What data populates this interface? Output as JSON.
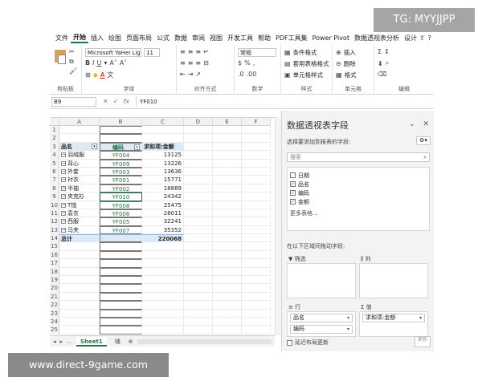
{
  "watermark": {
    "tg": "TG: MYYJJPP",
    "url": "www.direct-9game.com"
  },
  "ribbon": {
    "tabs": [
      "文件",
      "开始",
      "插入",
      "绘图",
      "页面布局",
      "公式",
      "数据",
      "审阅",
      "视图",
      "开发工具",
      "帮助",
      "PDF工具集",
      "Power Pivot",
      "数据透视表分析",
      "设计"
    ],
    "active_tab": "开始",
    "font_name": "Microsoft YaHei Lig",
    "font_size": "11",
    "number_format": "常规",
    "bold": "B",
    "italic": "I",
    "underline": "U",
    "cond_format": "条件格式",
    "table_format": "套用表格格式",
    "cell_style": "单元格样式",
    "insert": "插入",
    "delete": "删除",
    "format": "格式",
    "groups": [
      "剪贴板",
      "字体",
      "对齐方式",
      "数字",
      "样式",
      "单元格",
      "编辑"
    ]
  },
  "formula_bar": {
    "name_box": "B9",
    "value": "YF010",
    "fx": "fx"
  },
  "grid": {
    "columns": [
      "A",
      "B",
      "C",
      "D",
      "E",
      "F"
    ],
    "rows": [
      {
        "n": "1",
        "a": "",
        "b": "",
        "c": ""
      },
      {
        "n": "2",
        "a": "",
        "b": "",
        "c": ""
      },
      {
        "n": "3",
        "a": "品名",
        "b": "编码",
        "c": "求和项:金额",
        "type": "header"
      },
      {
        "n": "4",
        "a": "羽绒服",
        "b": "YF004",
        "c": "13125",
        "exp": true
      },
      {
        "n": "5",
        "a": "背心",
        "b": "YF009",
        "c": "13226",
        "exp": true
      },
      {
        "n": "6",
        "a": "外套",
        "b": "YF003",
        "c": "13636",
        "exp": true
      },
      {
        "n": "7",
        "a": "衬衣",
        "b": "YF001",
        "c": "15771",
        "exp": true
      },
      {
        "n": "8",
        "a": "半袖",
        "b": "YF002",
        "c": "18889",
        "exp": true
      },
      {
        "n": "9",
        "a": "夹克衫",
        "b": "YF010",
        "c": "24342",
        "exp": true,
        "sel": true
      },
      {
        "n": "10",
        "a": "T恤",
        "b": "YF008",
        "c": "25475",
        "exp": true
      },
      {
        "n": "11",
        "a": "袁衣",
        "b": "YF006",
        "c": "28011",
        "exp": true
      },
      {
        "n": "12",
        "a": "西服",
        "b": "YF005",
        "c": "32241",
        "exp": true
      },
      {
        "n": "13",
        "a": "马夹",
        "b": "YF007",
        "c": "35352",
        "exp": true
      },
      {
        "n": "14",
        "a": "总计",
        "b": "",
        "c": "220068",
        "type": "total"
      },
      {
        "n": "15",
        "a": "",
        "b": "",
        "c": ""
      },
      {
        "n": "16",
        "a": "",
        "b": "",
        "c": ""
      },
      {
        "n": "17",
        "a": "",
        "b": "",
        "c": ""
      },
      {
        "n": "18",
        "a": "",
        "b": "",
        "c": ""
      },
      {
        "n": "19",
        "a": "",
        "b": "",
        "c": ""
      },
      {
        "n": "20",
        "a": "",
        "b": "",
        "c": ""
      },
      {
        "n": "21",
        "a": "",
        "b": "",
        "c": ""
      },
      {
        "n": "22",
        "a": "",
        "b": "",
        "c": ""
      },
      {
        "n": "23",
        "a": "",
        "b": "",
        "c": ""
      },
      {
        "n": "24",
        "a": "",
        "b": "",
        "c": ""
      },
      {
        "n": "25",
        "a": "",
        "b": "",
        "c": ""
      }
    ]
  },
  "sheets": {
    "active": "Sheet1",
    "other": "辅"
  },
  "pivot_pane": {
    "title": "数据透视表字段",
    "subtitle": "选择要添加到报表的字段:",
    "search_placeholder": "搜索",
    "fields": [
      {
        "label": "日期",
        "checked": false
      },
      {
        "label": "品名",
        "checked": true
      },
      {
        "label": "编码",
        "checked": true
      },
      {
        "label": "金额",
        "checked": true
      }
    ],
    "more_tables": "更多表格...",
    "drag_hint": "在以下区域间拖动字段:",
    "areas": {
      "filter": "筛选",
      "columns": "列",
      "rows": "行",
      "values": "值",
      "row_fields": [
        "品名",
        "编码"
      ],
      "value_fields": [
        "求和项:金额"
      ]
    },
    "defer_label": "延迟布局更新",
    "update_label": "更新"
  }
}
